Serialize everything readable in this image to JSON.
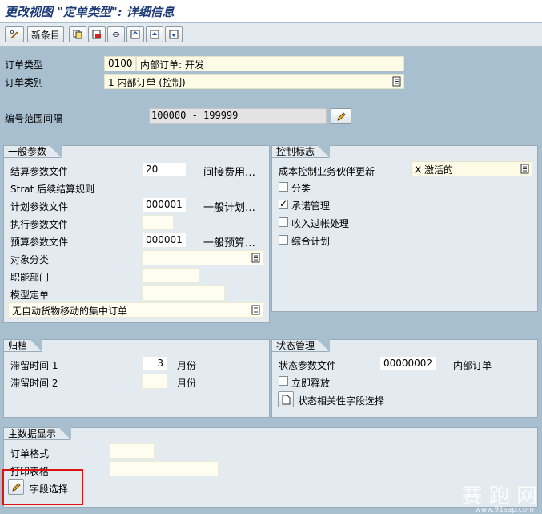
{
  "title": "更改视图 \"定单类型\": 详细信息",
  "toolbar": {
    "new_entries": "新条目"
  },
  "header": {
    "order_type_label": "订单类型",
    "order_type_code": "0100",
    "order_type_text": "内部订单: 开发",
    "order_category_label": "订单类别",
    "order_category_value": "1 内部订单 (控制)",
    "number_range_label": "编号范围间隔",
    "number_range_value": "100000 - 199999"
  },
  "general": {
    "title": "一般参数",
    "settlement_profile_label": "结算参数文件",
    "settlement_profile_value": "20",
    "settlement_profile_desc": "间接费用…",
    "strat_label": "Strat 后续结算规则",
    "planning_profile_label": "计划参数文件",
    "planning_profile_value": "000001",
    "planning_profile_desc": "一般计划…",
    "exec_profile_label": "执行参数文件",
    "budget_profile_label": "预算参数文件",
    "budget_profile_value": "000001",
    "budget_profile_desc": "一般预算…",
    "object_class_label": "对象分类",
    "func_area_label": "职能部门",
    "model_order_label": "模型定单",
    "collective_order_value": "无自动货物移动的集中订单"
  },
  "control": {
    "title": "控制标志",
    "cobp_label": "成本控制业务伙伴更新",
    "cobp_value": "X 激活的",
    "classification": "分类",
    "commitment": "承诺管理",
    "revenue": "收入过帐处理",
    "integrated": "综合计划",
    "classification_checked": false,
    "commitment_checked": true,
    "revenue_checked": false,
    "integrated_checked": false
  },
  "archiving": {
    "title": "归档",
    "residence1_label": "滞留时间 1",
    "residence1_value": "3",
    "residence1_unit": "月份",
    "residence2_label": "滞留时间 2",
    "residence2_unit": "月份"
  },
  "status": {
    "title": "状态管理",
    "profile_label": "状态参数文件",
    "profile_value": "00000002",
    "profile_desc": "内部订单",
    "release_label": "立即释放",
    "release_checked": false,
    "field_sel_label": "状态相关性字段选择"
  },
  "master": {
    "title": "主数据显示",
    "layout_label": "订单格式",
    "print_label": "打印表格",
    "field_sel_label": "字段选择"
  },
  "watermark": {
    "text": "赛 跑 网",
    "url": "www.91sap.com"
  },
  "colors": {
    "background": "#a8bfd0",
    "panel": "#e4ebf0",
    "highlight": "#e01010"
  }
}
